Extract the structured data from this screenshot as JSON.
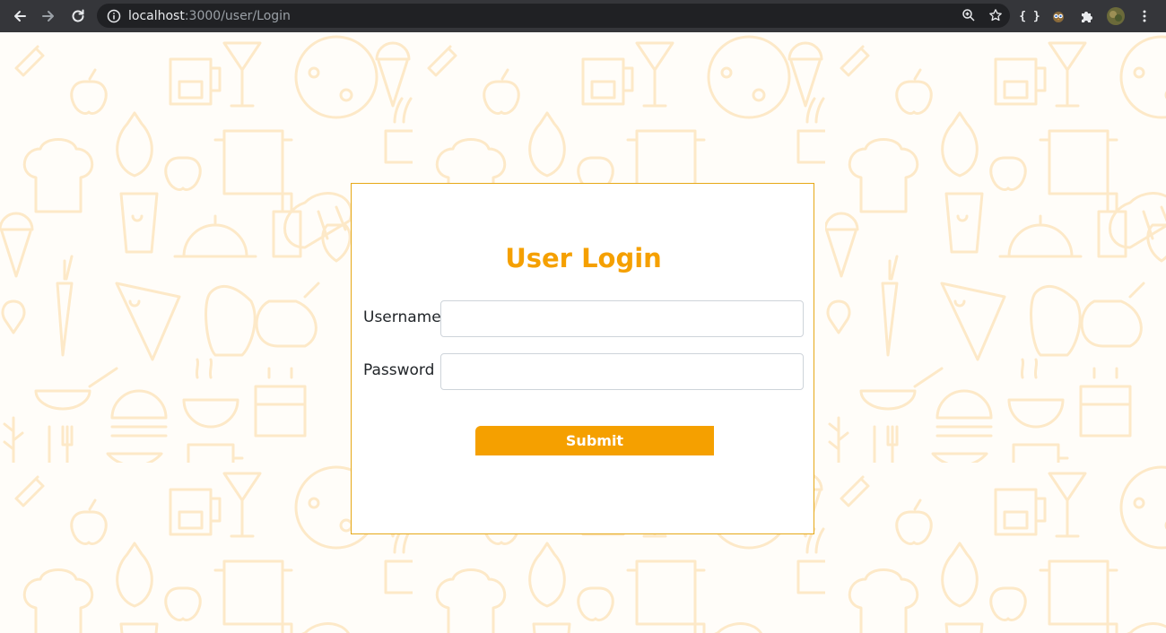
{
  "browser": {
    "url_host": "localhost",
    "url_path": ":3000/user/Login",
    "icons": [
      "back-icon",
      "forward-icon",
      "reload-icon",
      "info-icon",
      "zoom-icon",
      "bookmark-star-icon",
      "json-braces-icon",
      "extension-owl-icon",
      "extensions-puzzle-icon",
      "profile-avatar-icon",
      "menu-kebab-icon"
    ],
    "braces_label": "{ }"
  },
  "login": {
    "title": "User Login",
    "username_label": "Username",
    "username_value": "",
    "password_label": "Password",
    "password_value": "",
    "submit_label": "Submit"
  },
  "colors": {
    "accent": "#f5a000",
    "card_border": "#e6a817",
    "pattern": "#fde9c8",
    "chrome_bg": "#35363a",
    "omnibox_bg": "#202124"
  }
}
